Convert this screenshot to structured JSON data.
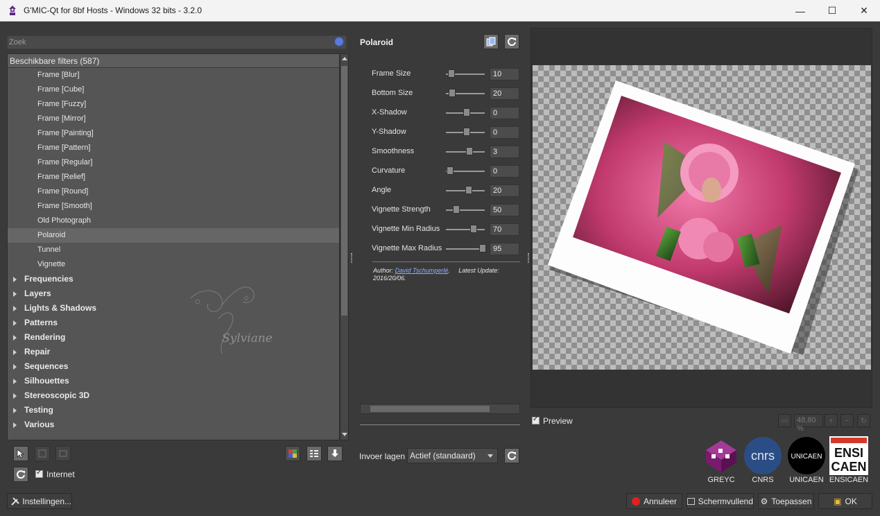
{
  "window": {
    "title": "G'MIC-Qt for 8bf Hosts - Windows 32 bits - 3.2.0"
  },
  "search": {
    "placeholder": "Zoek"
  },
  "tree": {
    "header": "Beschikbare filters (587)",
    "items": [
      "Frame [Blur]",
      "Frame [Cube]",
      "Frame [Fuzzy]",
      "Frame [Mirror]",
      "Frame [Painting]",
      "Frame [Pattern]",
      "Frame [Regular]",
      "Frame [Relief]",
      "Frame [Round]",
      "Frame [Smooth]",
      "Old Photograph",
      "Polaroid",
      "Tunnel",
      "Vignette"
    ],
    "selected": "Polaroid",
    "categories": [
      "Frequencies",
      "Layers",
      "Lights & Shadows",
      "Patterns",
      "Rendering",
      "Repair",
      "Sequences",
      "Silhouettes",
      "Stereoscopic 3D",
      "Testing",
      "Various"
    ]
  },
  "watermark": "Sylviane",
  "left_toolbar": {
    "internet_label": "Internet",
    "settings_label": "Instellingen..."
  },
  "filter": {
    "title": "Polaroid",
    "params": [
      {
        "name": "Frame Size",
        "value": "10",
        "level": 0.05
      },
      {
        "name": "Bottom Size",
        "value": "20",
        "level": 0.08
      },
      {
        "name": "X-Shadow",
        "value": "0",
        "level": 0.5
      },
      {
        "name": "Y-Shadow",
        "value": "0",
        "level": 0.5
      },
      {
        "name": "Smoothness",
        "value": "3",
        "level": 0.58
      },
      {
        "name": "Curvature",
        "value": "0",
        "level": 0.02
      },
      {
        "name": "Angle",
        "value": "20",
        "level": 0.55
      },
      {
        "name": "Vignette Strength",
        "value": "50",
        "level": 0.2
      },
      {
        "name": "Vignette Min Radius",
        "value": "70",
        "level": 0.7
      },
      {
        "name": "Vignette Max Radius",
        "value": "95",
        "level": 0.95
      }
    ],
    "author_label": "Author:",
    "author_name": "David Tschumperlé",
    "latest_update_label": "Latest Update:",
    "latest_update": "2016/20/06."
  },
  "input_layers": {
    "label": "Invoer lagen",
    "selected": "Actief (standaard)"
  },
  "preview": {
    "label": "Preview",
    "zoom": "48,80 %"
  },
  "logos": [
    "GREYC",
    "CNRS",
    "UNICAEN",
    "ENSICAEN"
  ],
  "buttons": {
    "cancel": "Annuleer",
    "fullscreen": "Schermvullend",
    "apply": "Toepassen",
    "ok": "OK"
  },
  "colors": {
    "greyc": "#7a1a6e",
    "cnrs": "#2b4d86",
    "cancel_dot": "#e02020"
  }
}
